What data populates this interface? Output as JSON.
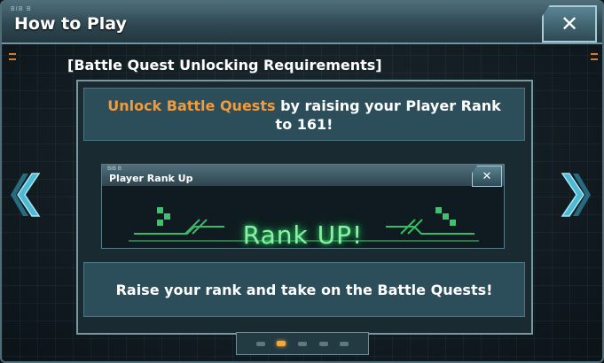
{
  "window": {
    "title": "How to Play",
    "title_decoration": "BIB B"
  },
  "content": {
    "heading": "[Battle Quest Unlocking Requirements]",
    "info_highlight": "Unlock Battle Quests",
    "info_rest": " by raising your Player Rank to 161!",
    "screenshot": {
      "decoration": "BIB B",
      "title": "Player Rank Up",
      "banner_text": "Rank UP!"
    },
    "bottom_message": "Raise your rank and take on the Battle Quests!"
  },
  "pager": {
    "count": 5,
    "active_index": 1
  },
  "colors": {
    "accent": "#f39a3a",
    "panel": "#2b4e5a",
    "rank_glow": "#8cf0a8"
  }
}
